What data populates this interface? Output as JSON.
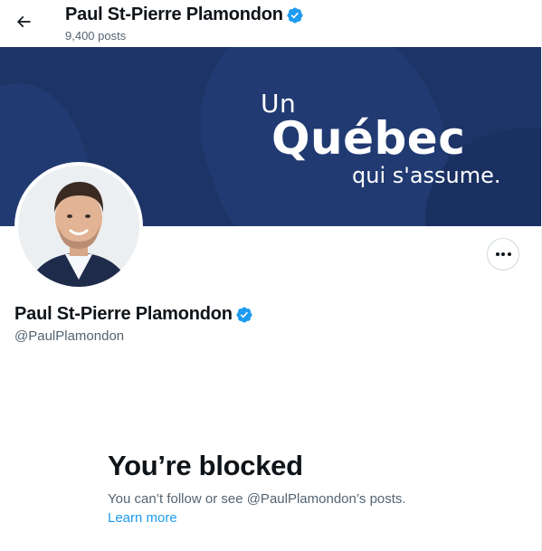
{
  "header": {
    "name": "Paul St-Pierre Plamondon",
    "post_count": "9,400 posts",
    "back_icon": "arrow-left-icon"
  },
  "banner": {
    "line1": "Un",
    "line2": "Québec",
    "line3": "qui s'assume.",
    "background_color": "#1d3466"
  },
  "profile": {
    "name": "Paul St-Pierre Plamondon",
    "handle": "@PaulPlamondon",
    "verified_icon": "verified-badge-icon",
    "more_icon": "more-horizontal-icon"
  },
  "blocked": {
    "title": "You’re blocked",
    "message": "You can’t follow or see @PaulPlamondon’s posts.",
    "link": "Learn more"
  },
  "colors": {
    "accent": "#1d9bf0",
    "text_primary": "#0f1419",
    "text_secondary": "#536471"
  }
}
